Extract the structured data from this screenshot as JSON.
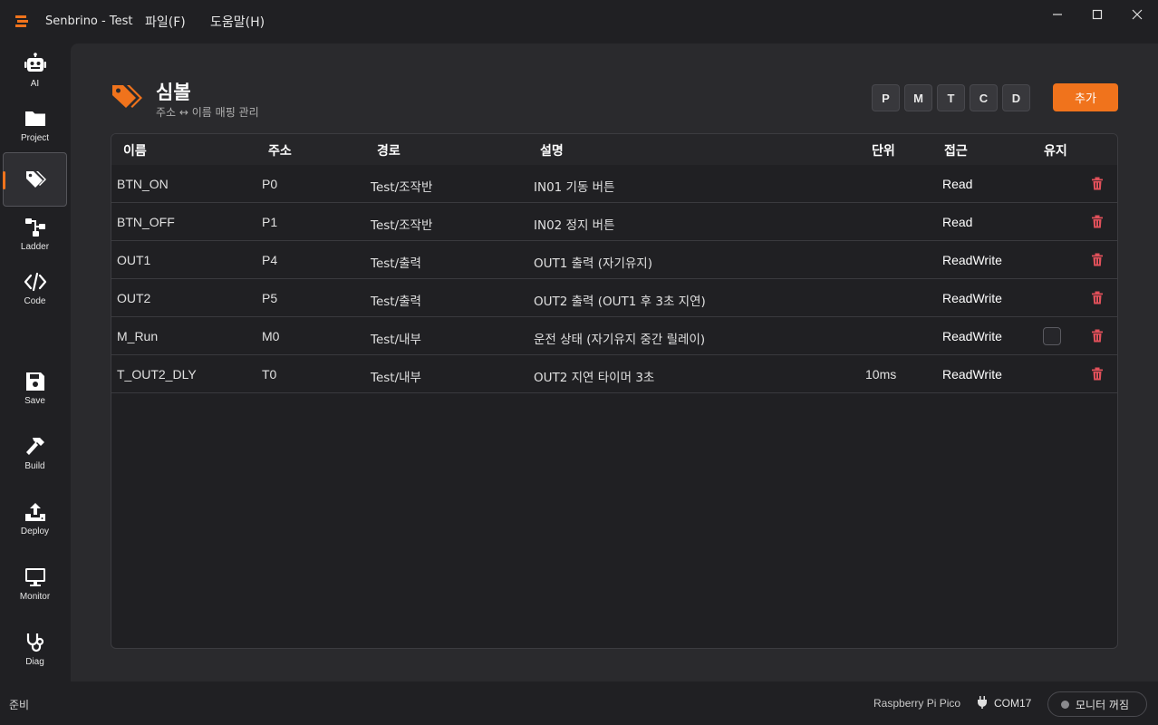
{
  "window": {
    "title": "Senbrino - Test",
    "menu": [
      "파일(F)",
      "도움말(H)"
    ]
  },
  "sidebar": {
    "items": [
      {
        "label": "AI",
        "icon": "robot-icon"
      },
      {
        "label": "Project",
        "icon": "folder-icon"
      },
      {
        "label": "",
        "icon": "tags-icon",
        "active": true
      },
      {
        "label": "Ladder",
        "icon": "ladder-icon"
      },
      {
        "label": "Code",
        "icon": "code-icon"
      },
      {
        "label": "Save",
        "icon": "save-icon"
      },
      {
        "label": "Build",
        "icon": "hammer-icon"
      },
      {
        "label": "Deploy",
        "icon": "upload-icon"
      },
      {
        "label": "Monitor",
        "icon": "monitor-icon"
      },
      {
        "label": "Diag",
        "icon": "stethoscope-icon"
      }
    ]
  },
  "header": {
    "title": "심볼",
    "subtitle": "주소 ↔ 이름 매핑 관리",
    "filters": [
      "P",
      "M",
      "T",
      "C",
      "D"
    ],
    "add_label": "추가"
  },
  "table": {
    "columns": [
      "이름",
      "주소",
      "경로",
      "설명",
      "단위",
      "접근",
      "유지"
    ],
    "rows": [
      {
        "name": "BTN_ON",
        "address": "P0",
        "path": "Test/조작반",
        "description": "IN01 기동 버튼",
        "unit": "",
        "access": "Read",
        "retain_checkbox": false
      },
      {
        "name": "BTN_OFF",
        "address": "P1",
        "path": "Test/조작반",
        "description": "IN02 정지 버튼",
        "unit": "",
        "access": "Read",
        "retain_checkbox": false
      },
      {
        "name": "OUT1",
        "address": "P4",
        "path": "Test/출력",
        "description": "OUT1 출력 (자기유지)",
        "unit": "",
        "access": "ReadWrite",
        "retain_checkbox": false
      },
      {
        "name": "OUT2",
        "address": "P5",
        "path": "Test/출력",
        "description": "OUT2 출력 (OUT1 후 3초 지연)",
        "unit": "",
        "access": "ReadWrite",
        "retain_checkbox": false
      },
      {
        "name": "M_Run",
        "address": "M0",
        "path": "Test/내부",
        "description": "운전 상태 (자기유지 중간 릴레이)",
        "unit": "",
        "access": "ReadWrite",
        "retain_checkbox": true
      },
      {
        "name": "T_OUT2_DLY",
        "address": "T0",
        "path": "Test/내부",
        "description": "OUT2 지연 타이머 3초",
        "unit": "10ms",
        "access": "ReadWrite",
        "retain_checkbox": false
      }
    ]
  },
  "status": {
    "text": "준비",
    "board": "Raspberry Pi Pico",
    "port": "COM17",
    "monitor_label": "모니터 꺼짐"
  },
  "colors": {
    "accent": "#f0731c",
    "delete": "#e0505a"
  }
}
